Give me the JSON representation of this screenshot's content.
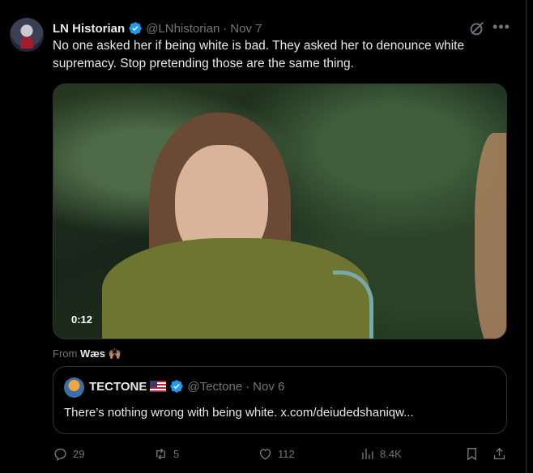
{
  "post": {
    "author_name": "LN Historian",
    "handle": "@LNhistorian",
    "separator": "·",
    "date": "Nov 7",
    "text": "No one asked her if being white is bad. They asked her to denounce white supremacy. Stop pretending those are the same thing.",
    "video_duration": "0:12",
    "from_prefix": "From",
    "from_name": "Wæs",
    "from_emoji": "🙌🏽"
  },
  "quote": {
    "author_name": "TECTONE",
    "handle": "@Tectone",
    "separator": "·",
    "date": "Nov 6",
    "text": "There’s nothing wrong with being white. x.com/deiudedshaniqw..."
  },
  "actions": {
    "replies": "29",
    "reposts": "5",
    "likes": "112",
    "views": "8.4K"
  },
  "colors": {
    "verified": "#1d9bf0",
    "muted": "#71767b",
    "text": "#e7e9ea",
    "border": "#2f3336"
  }
}
